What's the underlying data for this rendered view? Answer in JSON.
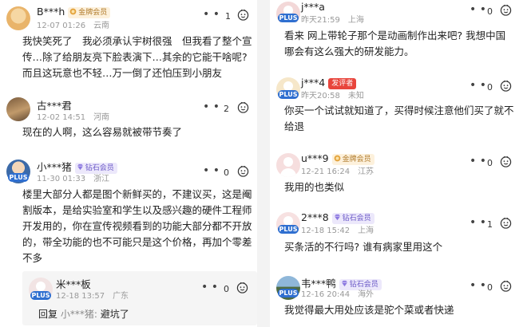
{
  "left": {
    "comments": [
      {
        "user": "B***h",
        "badge": "金牌会员",
        "date": "12-07 01:26",
        "location": "云南",
        "likes": "1",
        "lines": [
          "我快笑死了　我必须承认宇树很强　但我看了整个宣",
          "传…除了给朋友亮下脸表演下…其余的它能干啥呢?",
          "而且这玩意也不轻…万一倒了还怕压到小朋友"
        ]
      },
      {
        "user": "古***君",
        "date": "12-02 14:51",
        "location": "河南",
        "likes": "2",
        "lines": [
          "现在的人啊，这么容易就被带节奏了"
        ]
      },
      {
        "user": "小***猪",
        "badge": "钻石会员",
        "plus": "PLUS",
        "date": "11-30 01:33",
        "location": "浙江",
        "likes": "0",
        "lines": [
          "楼里大部分人都是图个新鲜买的，不建议买，这是阉",
          "割版本，是给实验室和学生以及感兴趣的硬件工程师",
          "开发用的，你在宣传视频看到的功能大部分都不开放",
          "的，带全功能的也不可能只是这个价格，再加个零差",
          "不多"
        ]
      }
    ],
    "reply": {
      "user": "米***板",
      "plus": "PLUS",
      "date": "12-18 13:57",
      "location": "广东",
      "likes": "0",
      "prefix": "回复",
      "reply_to": "小***猪:",
      "text": "避坑了"
    }
  },
  "right": {
    "comments": [
      {
        "user": "j***a",
        "plus": "PLUS",
        "date": "昨天21:59",
        "location": "上海",
        "likes": "0",
        "lines": [
          "看来 网上带轮子那个是动画制作出来吧? 我想中国",
          "哪会有这么强大的研发能力。"
        ]
      },
      {
        "user": "j***4",
        "badge": "发评者",
        "plus": "PLUS",
        "date": "昨天20:58",
        "location": "未知",
        "likes": "0",
        "lines": [
          "你买一个试试就知道了，买得时候注意他们买了就不",
          "给退"
        ]
      },
      {
        "user": "u***9",
        "badge": "金牌会员",
        "date": "12-21 16:24",
        "location": "江苏",
        "likes": "0",
        "lines": [
          "我用的也类似"
        ]
      },
      {
        "user": "2***8",
        "badge": "钻石会员",
        "plus": "PLUS",
        "date": "12-18 15:42",
        "location": "上海",
        "likes": "1",
        "lines": [
          "买条活的不行吗? 谁有病家里用这个"
        ]
      },
      {
        "user": "韦***鸭",
        "badge": "钻石会员",
        "plus": "PLUS",
        "date": "12-16 20:44",
        "location": "海外",
        "likes": "0",
        "lines": [
          "我觉得最大用处应该是驼个菜或者快递"
        ]
      }
    ]
  },
  "colors": {
    "gold": "#b07a2a",
    "diamond": "#6a58c7",
    "author": "#e8453c",
    "plus": "#2f6fd0",
    "meta": "#999999"
  },
  "icons": {
    "more": "more-dots-icon",
    "like": "thumb-face-icon",
    "gold_badge": "gold-medal-icon",
    "diamond_badge": "diamond-icon"
  }
}
